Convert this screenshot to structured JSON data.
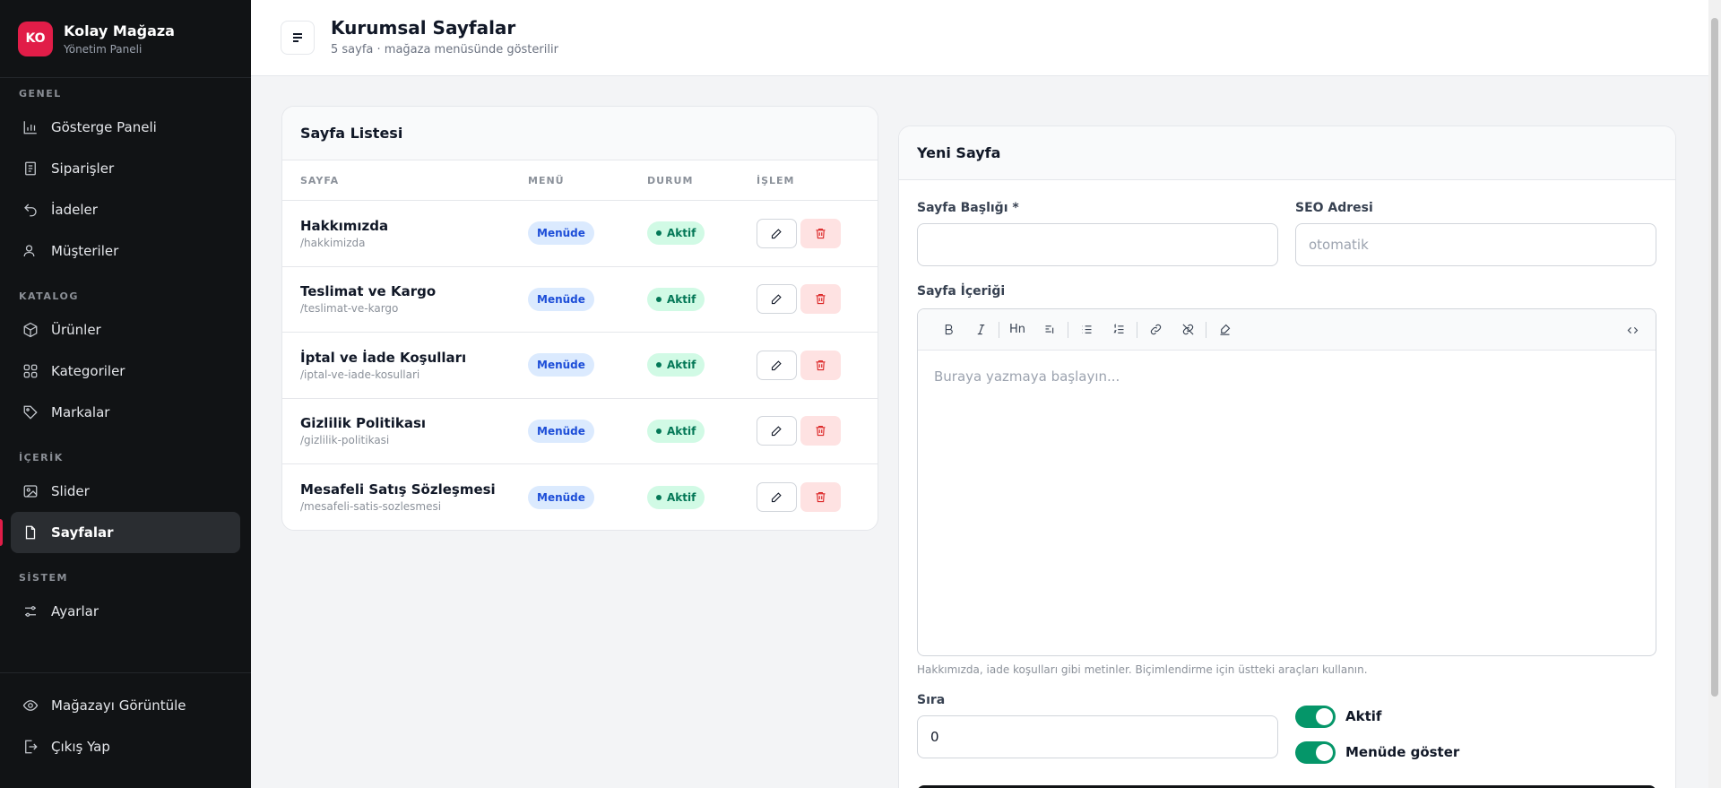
{
  "brand": {
    "initials": "KO",
    "name": "Kolay Mağaza",
    "subtitle": "Yönetim Paneli",
    "accent": "#e11d48"
  },
  "sidebar": {
    "sections": [
      {
        "title": "GENEL",
        "items": [
          {
            "label": "Gösterge Paneli",
            "icon": "bar-chart-icon"
          },
          {
            "label": "Siparişler",
            "icon": "receipt-icon"
          },
          {
            "label": "İadeler",
            "icon": "undo-icon"
          },
          {
            "label": "Müşteriler",
            "icon": "user-icon"
          }
        ]
      },
      {
        "title": "KATALOG",
        "items": [
          {
            "label": "Ürünler",
            "icon": "box-icon"
          },
          {
            "label": "Kategoriler",
            "icon": "grid-icon"
          },
          {
            "label": "Markalar",
            "icon": "tag-icon"
          }
        ]
      },
      {
        "title": "İÇERİK",
        "items": [
          {
            "label": "Slider",
            "icon": "image-icon"
          },
          {
            "label": "Sayfalar",
            "icon": "file-icon",
            "active": true
          }
        ]
      },
      {
        "title": "SİSTEM",
        "items": [
          {
            "label": "Ayarlar",
            "icon": "sliders-icon"
          }
        ]
      }
    ],
    "bottom": [
      {
        "label": "Mağazayı Görüntüle",
        "icon": "eye-icon"
      },
      {
        "label": "Çıkış Yap",
        "icon": "logout-icon"
      }
    ]
  },
  "header": {
    "title": "Kurumsal Sayfalar",
    "subtitle": "5 sayfa · mağaza menüsünde gösterilir"
  },
  "list": {
    "title": "Sayfa Listesi",
    "columns": [
      "SAYFA",
      "MENÜ",
      "DURUM",
      "İŞLEM"
    ],
    "rows": [
      {
        "title": "Hakkımızda",
        "slug": "/hakkimizda",
        "menu": "Menüde",
        "status": "Aktif"
      },
      {
        "title": "Teslimat ve Kargo",
        "slug": "/teslimat-ve-kargo",
        "menu": "Menüde",
        "status": "Aktif"
      },
      {
        "title": "İptal ve İade Koşulları",
        "slug": "/iptal-ve-iade-kosullari",
        "menu": "Menüde",
        "status": "Aktif"
      },
      {
        "title": "Gizlilik Politikası",
        "slug": "/gizlilik-politikasi",
        "menu": "Menüde",
        "status": "Aktif"
      },
      {
        "title": "Mesafeli Satış Sözleşmesi",
        "slug": "/mesafeli-satis-sozlesmesi",
        "menu": "Menüde",
        "status": "Aktif"
      }
    ]
  },
  "form": {
    "title": "Yeni Sayfa",
    "page_title_label": "Sayfa Başlığı *",
    "page_title_value": "",
    "seo_label": "SEO Adresi",
    "seo_placeholder": "otomatik",
    "content_label": "Sayfa İçeriği",
    "editor_placeholder": "Buraya yazmaya başlayın...",
    "toolbar": [
      "bold-icon",
      "italic-icon",
      "heading-icon",
      "paragraph-icon",
      "bullet-list-icon",
      "ordered-list-icon",
      "link-icon",
      "unlink-icon",
      "clear-format-icon",
      "code-icon"
    ],
    "heading_glyph": "Hn",
    "hint": "Hakkımızda, iade koşulları gibi metinler. Biçimlendirme için üstteki araçları kullanın.",
    "order_label": "Sıra",
    "order_value": "0",
    "active_label": "Aktif",
    "active": true,
    "menu_toggle_label": "Menüde göster",
    "menu_toggle": true,
    "toggle_color": "#059669"
  }
}
